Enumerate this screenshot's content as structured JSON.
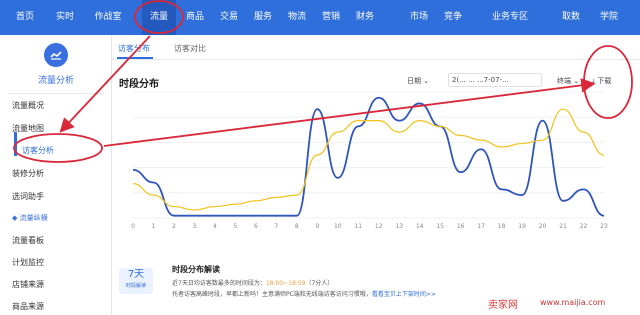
{
  "topnav": {
    "items": [
      {
        "label": "首页"
      },
      {
        "label": "实时"
      },
      {
        "label": "作战室"
      },
      {
        "label": "流量"
      },
      {
        "label": "商品"
      },
      {
        "label": "交易"
      },
      {
        "label": "服务"
      },
      {
        "label": "物流"
      },
      {
        "label": "营销"
      },
      {
        "label": "财务"
      },
      {
        "label": "市场"
      },
      {
        "label": "竞争"
      },
      {
        "label": "业务专区"
      },
      {
        "label": "取数"
      },
      {
        "label": "学院"
      }
    ],
    "active_index": 3
  },
  "sidebar": {
    "title": "流量分析",
    "items": [
      {
        "label": "流量概况"
      },
      {
        "label": "流量地图"
      },
      {
        "label": "访客分析"
      },
      {
        "label": "装修分析"
      },
      {
        "label": "选词助手"
      }
    ],
    "group_label": "流量纵横",
    "group_items": [
      {
        "label": "流量看板"
      },
      {
        "label": "计划监控"
      },
      {
        "label": "店铺来源"
      },
      {
        "label": "商品来源"
      }
    ],
    "active_item": "访客分析"
  },
  "main": {
    "tabs": [
      {
        "label": "访客分布"
      },
      {
        "label": "访客对比"
      }
    ],
    "section_title": "时段分布",
    "date_label": "日期",
    "date_value": "2(... ... ...7-07-...",
    "terminal_label": "终端",
    "download_label": "下载",
    "interpretation": {
      "title": "时段分布解读",
      "badge_number": "7天",
      "badge_sub": "时段解读",
      "line1_prefix": "近7天日均访客数最多的时间段为：",
      "line1_highlight": "18:00~18:59",
      "line1_suffix": "（7分人）",
      "line2_text": "托者访客高峰时段，早都上新吗！主意满师PC端和无线端访客访问习惯哦，",
      "line2_link": "看看宝贝上下架时间>>"
    }
  },
  "watermark": {
    "text": "卖家网",
    "url": "www.maijia.com"
  },
  "chart_data": {
    "type": "line",
    "x": [
      0,
      1,
      2,
      3,
      4,
      5,
      6,
      7,
      8,
      9,
      10,
      11,
      12,
      13,
      14,
      15,
      16,
      17,
      18,
      19,
      20,
      21,
      22,
      23
    ],
    "series": [
      {
        "color": "#2f55b8",
        "values": [
          42,
          31,
          2,
          2,
          2,
          2,
          2,
          2,
          2,
          95,
          35,
          80,
          105,
          85,
          100,
          80,
          40,
          60,
          25,
          20,
          85,
          15,
          25,
          2
        ]
      },
      {
        "color": "#f2c21b",
        "values": [
          30,
          20,
          10,
          7,
          10,
          12,
          15,
          18,
          20,
          55,
          75,
          85,
          85,
          75,
          85,
          80,
          72,
          68,
          62,
          65,
          68,
          95,
          75,
          55
        ]
      }
    ],
    "xlabels": [
      "0",
      "1",
      "2",
      "3",
      "4",
      "5",
      "6",
      "7",
      "8",
      "9",
      "10",
      "11",
      "12",
      "13",
      "14",
      "15",
      "16",
      "17",
      "18",
      "19",
      "20",
      "21",
      "22",
      "23"
    ],
    "ylim": [
      0,
      110
    ],
    "grid": true,
    "accent": "#2f6fdb",
    "annotation_color": "#d9283a"
  }
}
